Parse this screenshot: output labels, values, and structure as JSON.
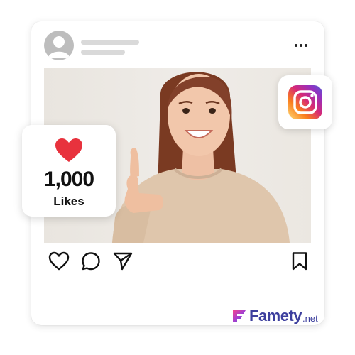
{
  "likes_card": {
    "count": "1,000",
    "label": "Likes"
  },
  "post": {
    "actions": [
      "heart-icon",
      "comment-icon",
      "share-icon",
      "bookmark-icon"
    ]
  },
  "brand": {
    "name": "Famety",
    "tld": ".net"
  },
  "colors": {
    "heart": "#e8323d",
    "brand": "#3d3f9e",
    "placeholder": "#d9d9d9",
    "avatar": "#bdbdbd"
  }
}
